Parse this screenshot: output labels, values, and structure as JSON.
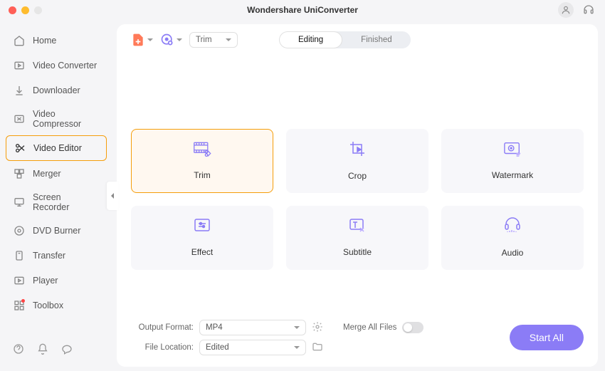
{
  "app": {
    "title": "Wondershare UniConverter"
  },
  "sidebar": {
    "items": [
      {
        "label": "Home"
      },
      {
        "label": "Video Converter"
      },
      {
        "label": "Downloader"
      },
      {
        "label": "Video Compressor"
      },
      {
        "label": "Video Editor"
      },
      {
        "label": "Merger"
      },
      {
        "label": "Screen Recorder"
      },
      {
        "label": "DVD Burner"
      },
      {
        "label": "Transfer"
      },
      {
        "label": "Player"
      },
      {
        "label": "Toolbox"
      }
    ]
  },
  "toolbar": {
    "trim_select": "Trim",
    "editing_tab": "Editing",
    "finished_tab": "Finished"
  },
  "cards": [
    {
      "label": "Trim"
    },
    {
      "label": "Crop"
    },
    {
      "label": "Watermark"
    },
    {
      "label": "Effect"
    },
    {
      "label": "Subtitle"
    },
    {
      "label": "Audio"
    }
  ],
  "bottom": {
    "output_format_label": "Output Format:",
    "output_format_value": "MP4",
    "file_location_label": "File Location:",
    "file_location_value": "Edited",
    "merge_label": "Merge All Files",
    "start_label": "Start  All"
  }
}
